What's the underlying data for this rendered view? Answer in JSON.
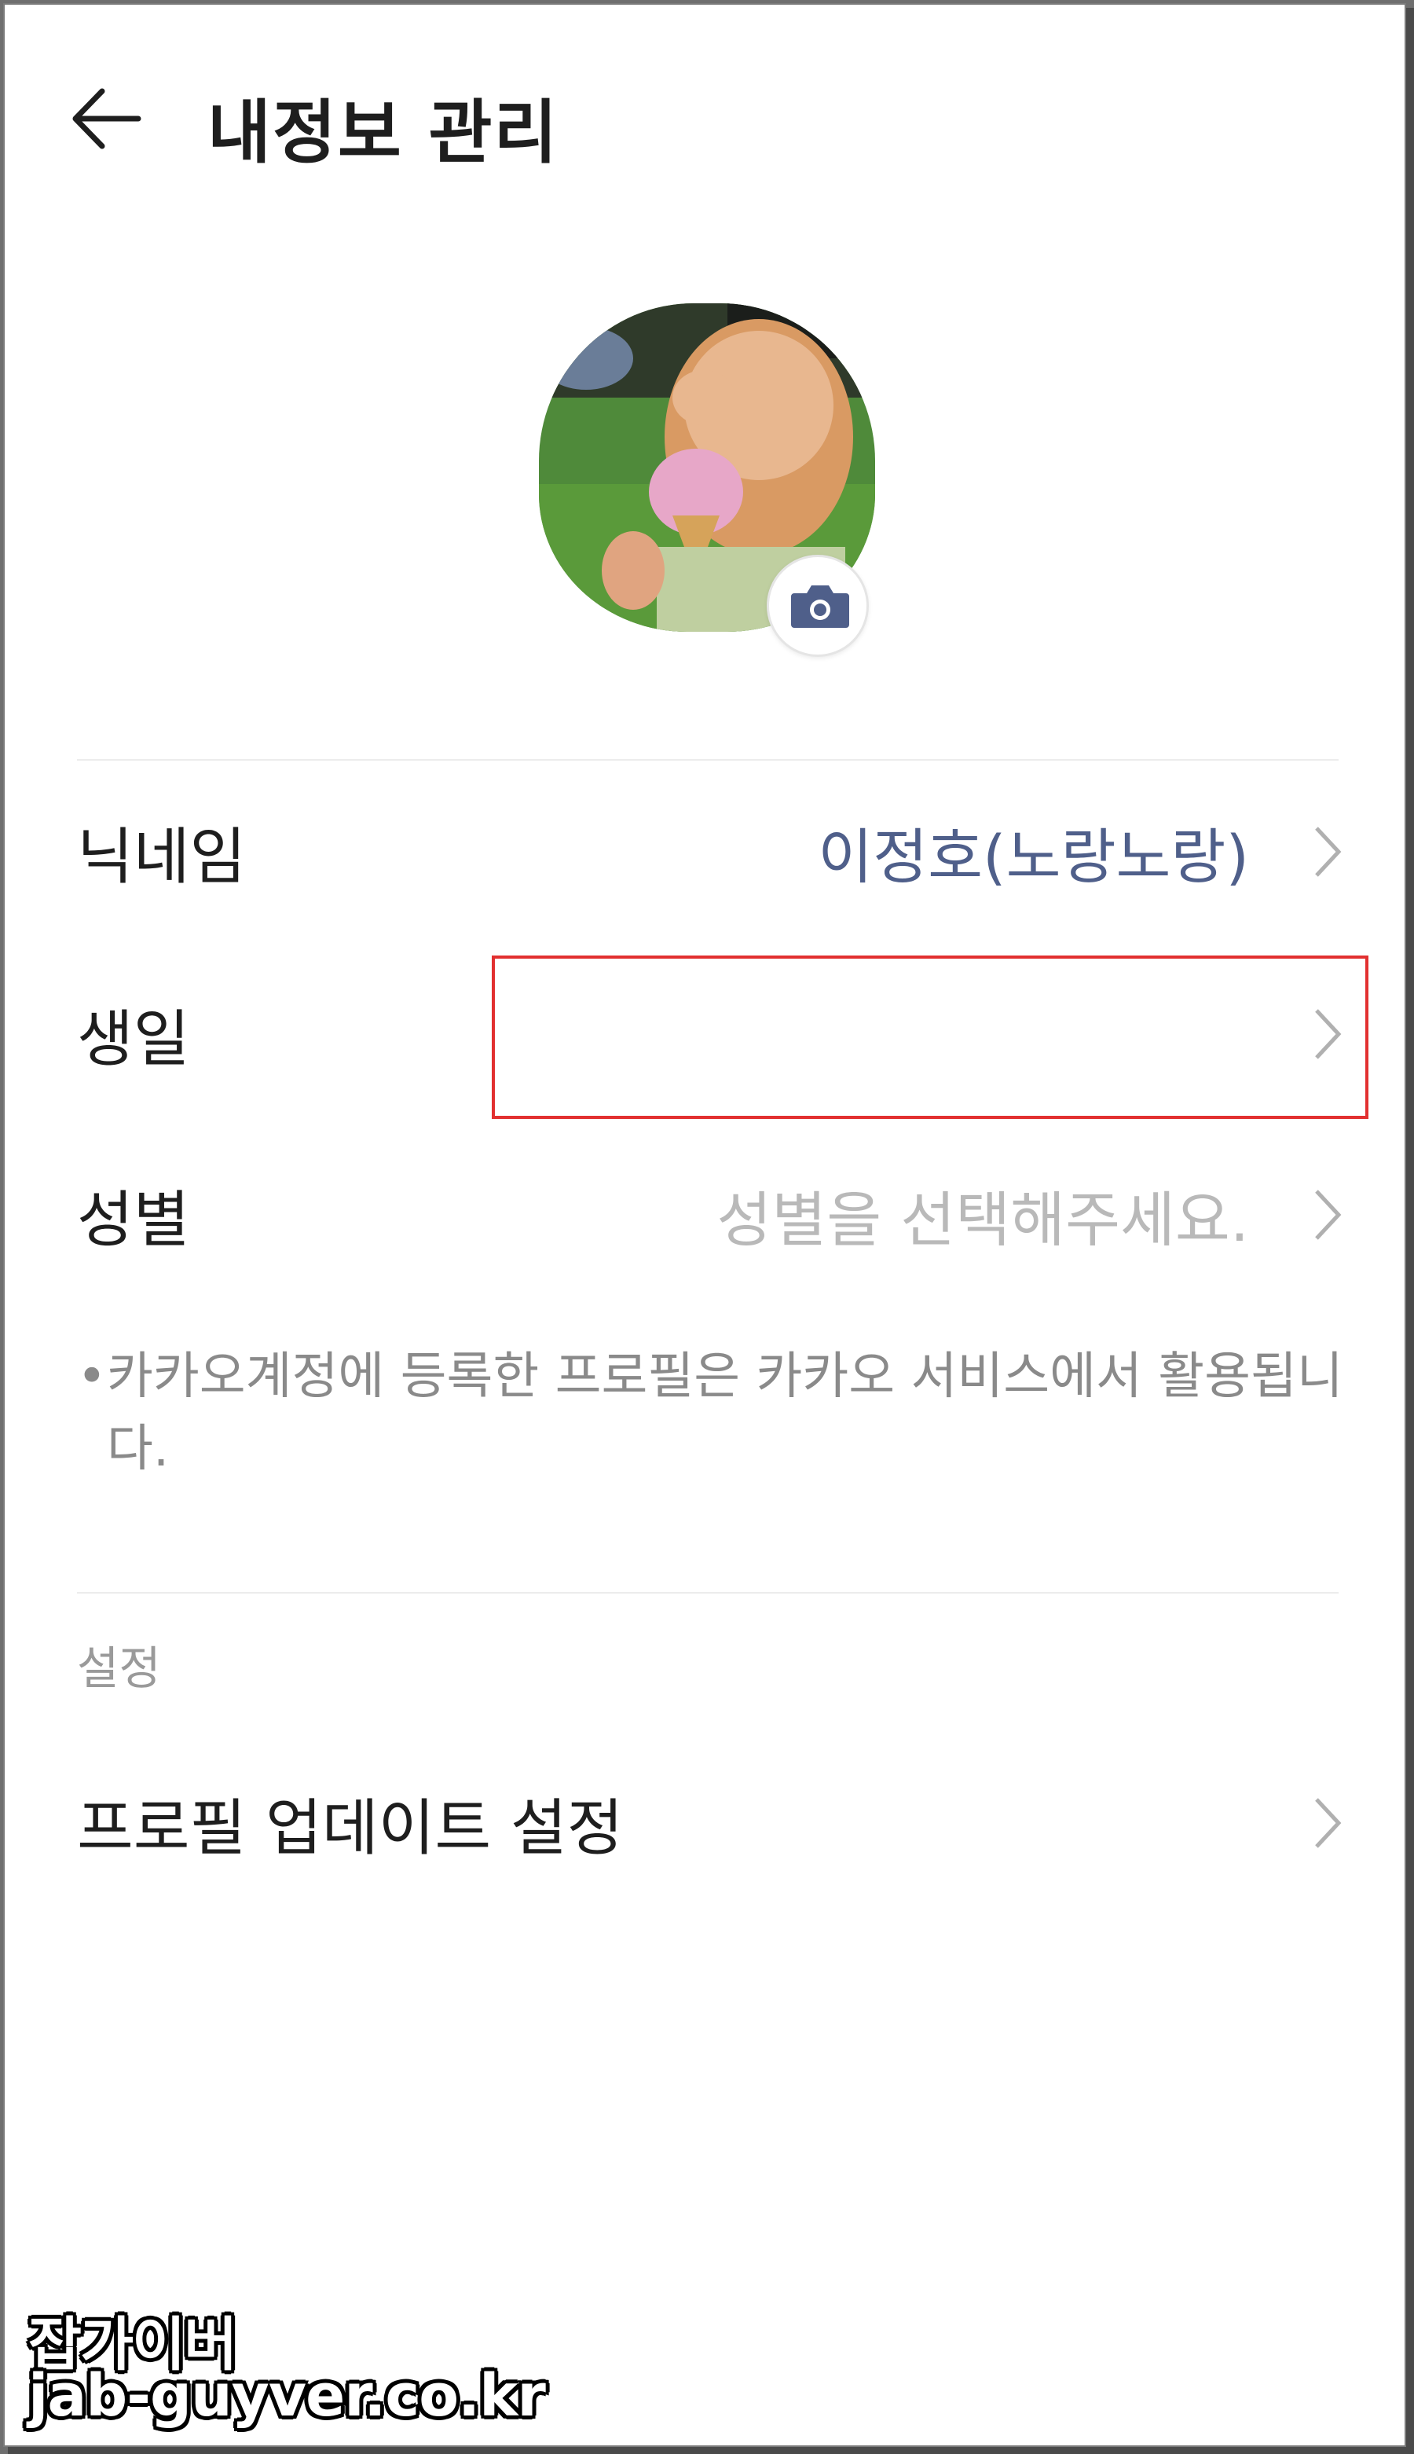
{
  "header": {
    "title": "내정보 관리"
  },
  "profile": {
    "avatar_icon": "profile-photo",
    "camera_icon": "camera-icon"
  },
  "fields": [
    {
      "label": "닉네임",
      "value": "이정호(노랑노랑)"
    },
    {
      "label": "생일",
      "value": ""
    },
    {
      "label": "성별",
      "placeholder": "성별을 선택해주세요."
    }
  ],
  "notice": {
    "bullet": "•",
    "text": "카카오계정에 등록한 프로필은 카카오 서비스에서 활용됩니다."
  },
  "settings": {
    "section_title": "설정",
    "items": [
      {
        "label": "프로필 업데이트 설정"
      }
    ]
  },
  "watermark": {
    "name": "잡가이버",
    "url": "jab-guyver.co.kr"
  },
  "colors": {
    "accent_value": "#4f5f8a",
    "placeholder": "#b9b9b9",
    "highlight": "#e23030",
    "camera": "#4f5f8a"
  }
}
